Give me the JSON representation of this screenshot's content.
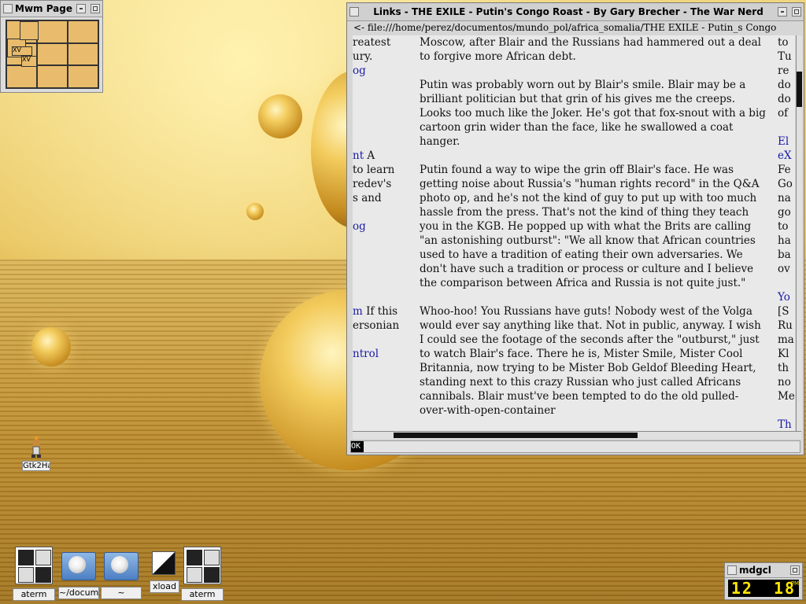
{
  "pager": {
    "title": "Mwm Page",
    "mini_windows": [
      "XV",
      "XV"
    ]
  },
  "browser": {
    "title": "Links - THE EXILE - Putin's Congo Roast - By Gary Brecher - The War Nerd",
    "url": "<- file:///home/perez/documentos/mundo_pol/africa_somalia/THE EXILE - Putin_s Congo",
    "left_column": [
      {
        "text": "reatest",
        "link": false,
        "line": 0
      },
      {
        "text": "ury.",
        "link": false,
        "line": 1
      },
      {
        "text": "og",
        "link": true,
        "line": 2
      },
      {
        "text": "nt",
        "link": true,
        "extra": " A",
        "line": 8
      },
      {
        "text": " to learn",
        "link": false,
        "line": 9
      },
      {
        "text": "redev's",
        "link": false,
        "line": 10
      },
      {
        "text": "s and",
        "link": false,
        "line": 11
      },
      {
        "text": "og",
        "link": true,
        "line": 13
      },
      {
        "text": "m",
        "link": true,
        "extra": " If this",
        "line": 19
      },
      {
        "text": "ersonian",
        "link": false,
        "line": 20
      },
      {
        "text": "ntrol",
        "link": true,
        "line": 22
      }
    ],
    "paragraphs": [
      "Moscow, after Blair and the Russians had hammered out a deal to forgive more African debt.",
      "Putin was probably worn out by Blair's smile. Blair may be a brilliant politician but that grin of his gives me the creeps. Looks too much like the Joker. He's got that fox-snout with a big cartoon grin wider than the face, like he swallowed a coat hanger.",
      "Putin found a way to wipe the grin off Blair's face. He was getting noise about Russia's \"human rights record\" in the Q&A photo op, and he's not the kind of guy to put up with too much hassle from the press. That's not the kind of thing they teach you in the KGB. He popped up with what the Brits are calling \"an astonishing outburst\": \"We all know that African countries used to have a tradition of eating their own adversaries. We don't have such a tradition or process or culture and I believe the comparison between Africa and Russia is not quite just.\"",
      "Whoo-hoo! You Russians have guts! Nobody west of the Volga would ever say anything like that. Not in public, anyway. I wish I could see the footage of the seconds after the \"outburst,\" just to watch Blair's face. There he is, Mister Smile, Mister Cool Britannia, now trying to be Mister Bob Geldof Bleeding Heart, standing next to this crazy Russian who just called Africans cannibals. Blair must've been tempted to do the old pulled-over-with-open-container"
    ],
    "right_column": [
      {
        "text": "to",
        "link": false,
        "line": 0
      },
      {
        "text": "Tu",
        "link": false,
        "line": 1
      },
      {
        "text": "re",
        "link": false,
        "line": 2
      },
      {
        "text": "do",
        "link": false,
        "line": 3
      },
      {
        "text": "do",
        "link": false,
        "line": 4
      },
      {
        "text": "of",
        "link": false,
        "line": 5
      },
      {
        "text": "El",
        "link": true,
        "line": 7
      },
      {
        "text": "eX",
        "link": true,
        "line": 8
      },
      {
        "text": "Fe",
        "link": false,
        "line": 9
      },
      {
        "text": "Go",
        "link": false,
        "line": 10
      },
      {
        "text": "na",
        "link": false,
        "line": 11
      },
      {
        "text": "go",
        "link": false,
        "line": 12
      },
      {
        "text": "to",
        "link": false,
        "line": 13
      },
      {
        "text": "ha",
        "link": false,
        "line": 14
      },
      {
        "text": "ba",
        "link": false,
        "line": 15
      },
      {
        "text": "ov",
        "link": false,
        "line": 16
      },
      {
        "text": "Yo",
        "link": true,
        "line": 18
      },
      {
        "text": "[S",
        "link": false,
        "line": 19
      },
      {
        "text": "Ru",
        "link": false,
        "line": 20
      },
      {
        "text": "ma",
        "link": false,
        "line": 21
      },
      {
        "text": "Kl",
        "link": false,
        "line": 22
      },
      {
        "text": "th",
        "link": false,
        "line": 23
      },
      {
        "text": "no",
        "link": false,
        "line": 24
      },
      {
        "text": "Me",
        "link": false,
        "line": 25
      },
      {
        "text": "Th",
        "link": true,
        "line": 27
      }
    ],
    "status_button": "OK",
    "vertical_scroll_fraction": 0.1,
    "horizontal_scroll_fraction": 0.2
  },
  "desktop_icons": [
    {
      "label": "Gtk2Ha",
      "icon": "gtk2hack-icon"
    }
  ],
  "dock": [
    {
      "label": "aterm",
      "icon": "aterm-icon"
    },
    {
      "label": "~/docume",
      "icon": "folder-icon"
    },
    {
      "label": "~",
      "icon": "folder-icon"
    },
    {
      "label": "xload",
      "icon": "xload-icon"
    },
    {
      "label": "aterm",
      "icon": "aterm-icon"
    }
  ],
  "clock": {
    "title": "mdgcl",
    "hour": "12",
    "minute": "18",
    "ampm": "PM"
  }
}
